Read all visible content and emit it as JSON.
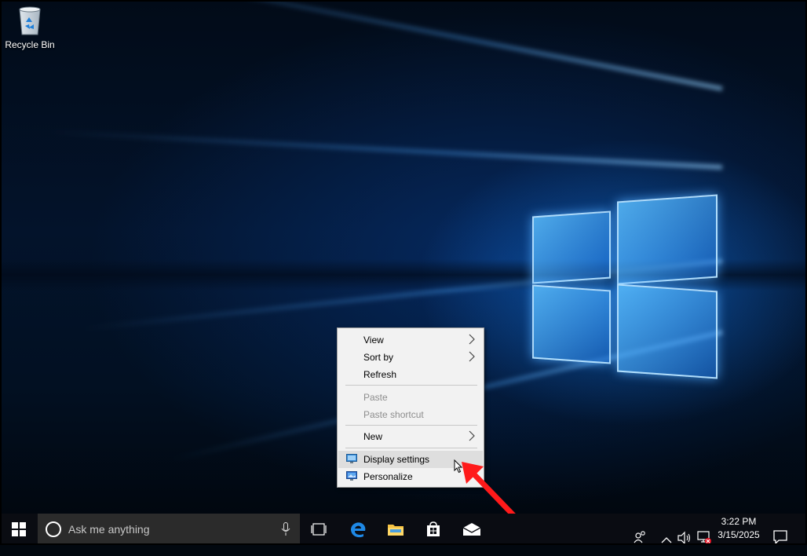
{
  "desktop": {
    "icons": [
      {
        "label": "Recycle Bin",
        "icon": "recycle-bin-icon"
      }
    ]
  },
  "context_menu": {
    "items": {
      "view": {
        "label": "View",
        "submenu": true
      },
      "sort_by": {
        "label": "Sort by",
        "submenu": true
      },
      "refresh": {
        "label": "Refresh"
      },
      "paste": {
        "label": "Paste",
        "disabled": true
      },
      "paste_shortcut": {
        "label": "Paste shortcut",
        "disabled": true
      },
      "new": {
        "label": "New",
        "submenu": true
      },
      "display_settings": {
        "label": "Display settings",
        "icon": "display-settings-icon",
        "hovered": true
      },
      "personalize": {
        "label": "Personalize",
        "icon": "personalize-icon"
      }
    }
  },
  "taskbar": {
    "search": {
      "placeholder": "Ask me anything"
    },
    "pinned_apps": [
      "task-view-icon",
      "edge-icon",
      "file-explorer-icon",
      "store-icon",
      "mail-icon"
    ],
    "tray_icons": [
      "people-icon",
      "show-hidden-icons-icon",
      "volume-icon",
      "network-icon",
      "action-center-icon"
    ],
    "clock": {
      "time": "3:22 PM",
      "date": "3/15/2025"
    }
  },
  "colors": {
    "accent": "#0a74da",
    "annotation_arrow": "#ff1a1a",
    "menu_background": "#f2f2f2"
  }
}
